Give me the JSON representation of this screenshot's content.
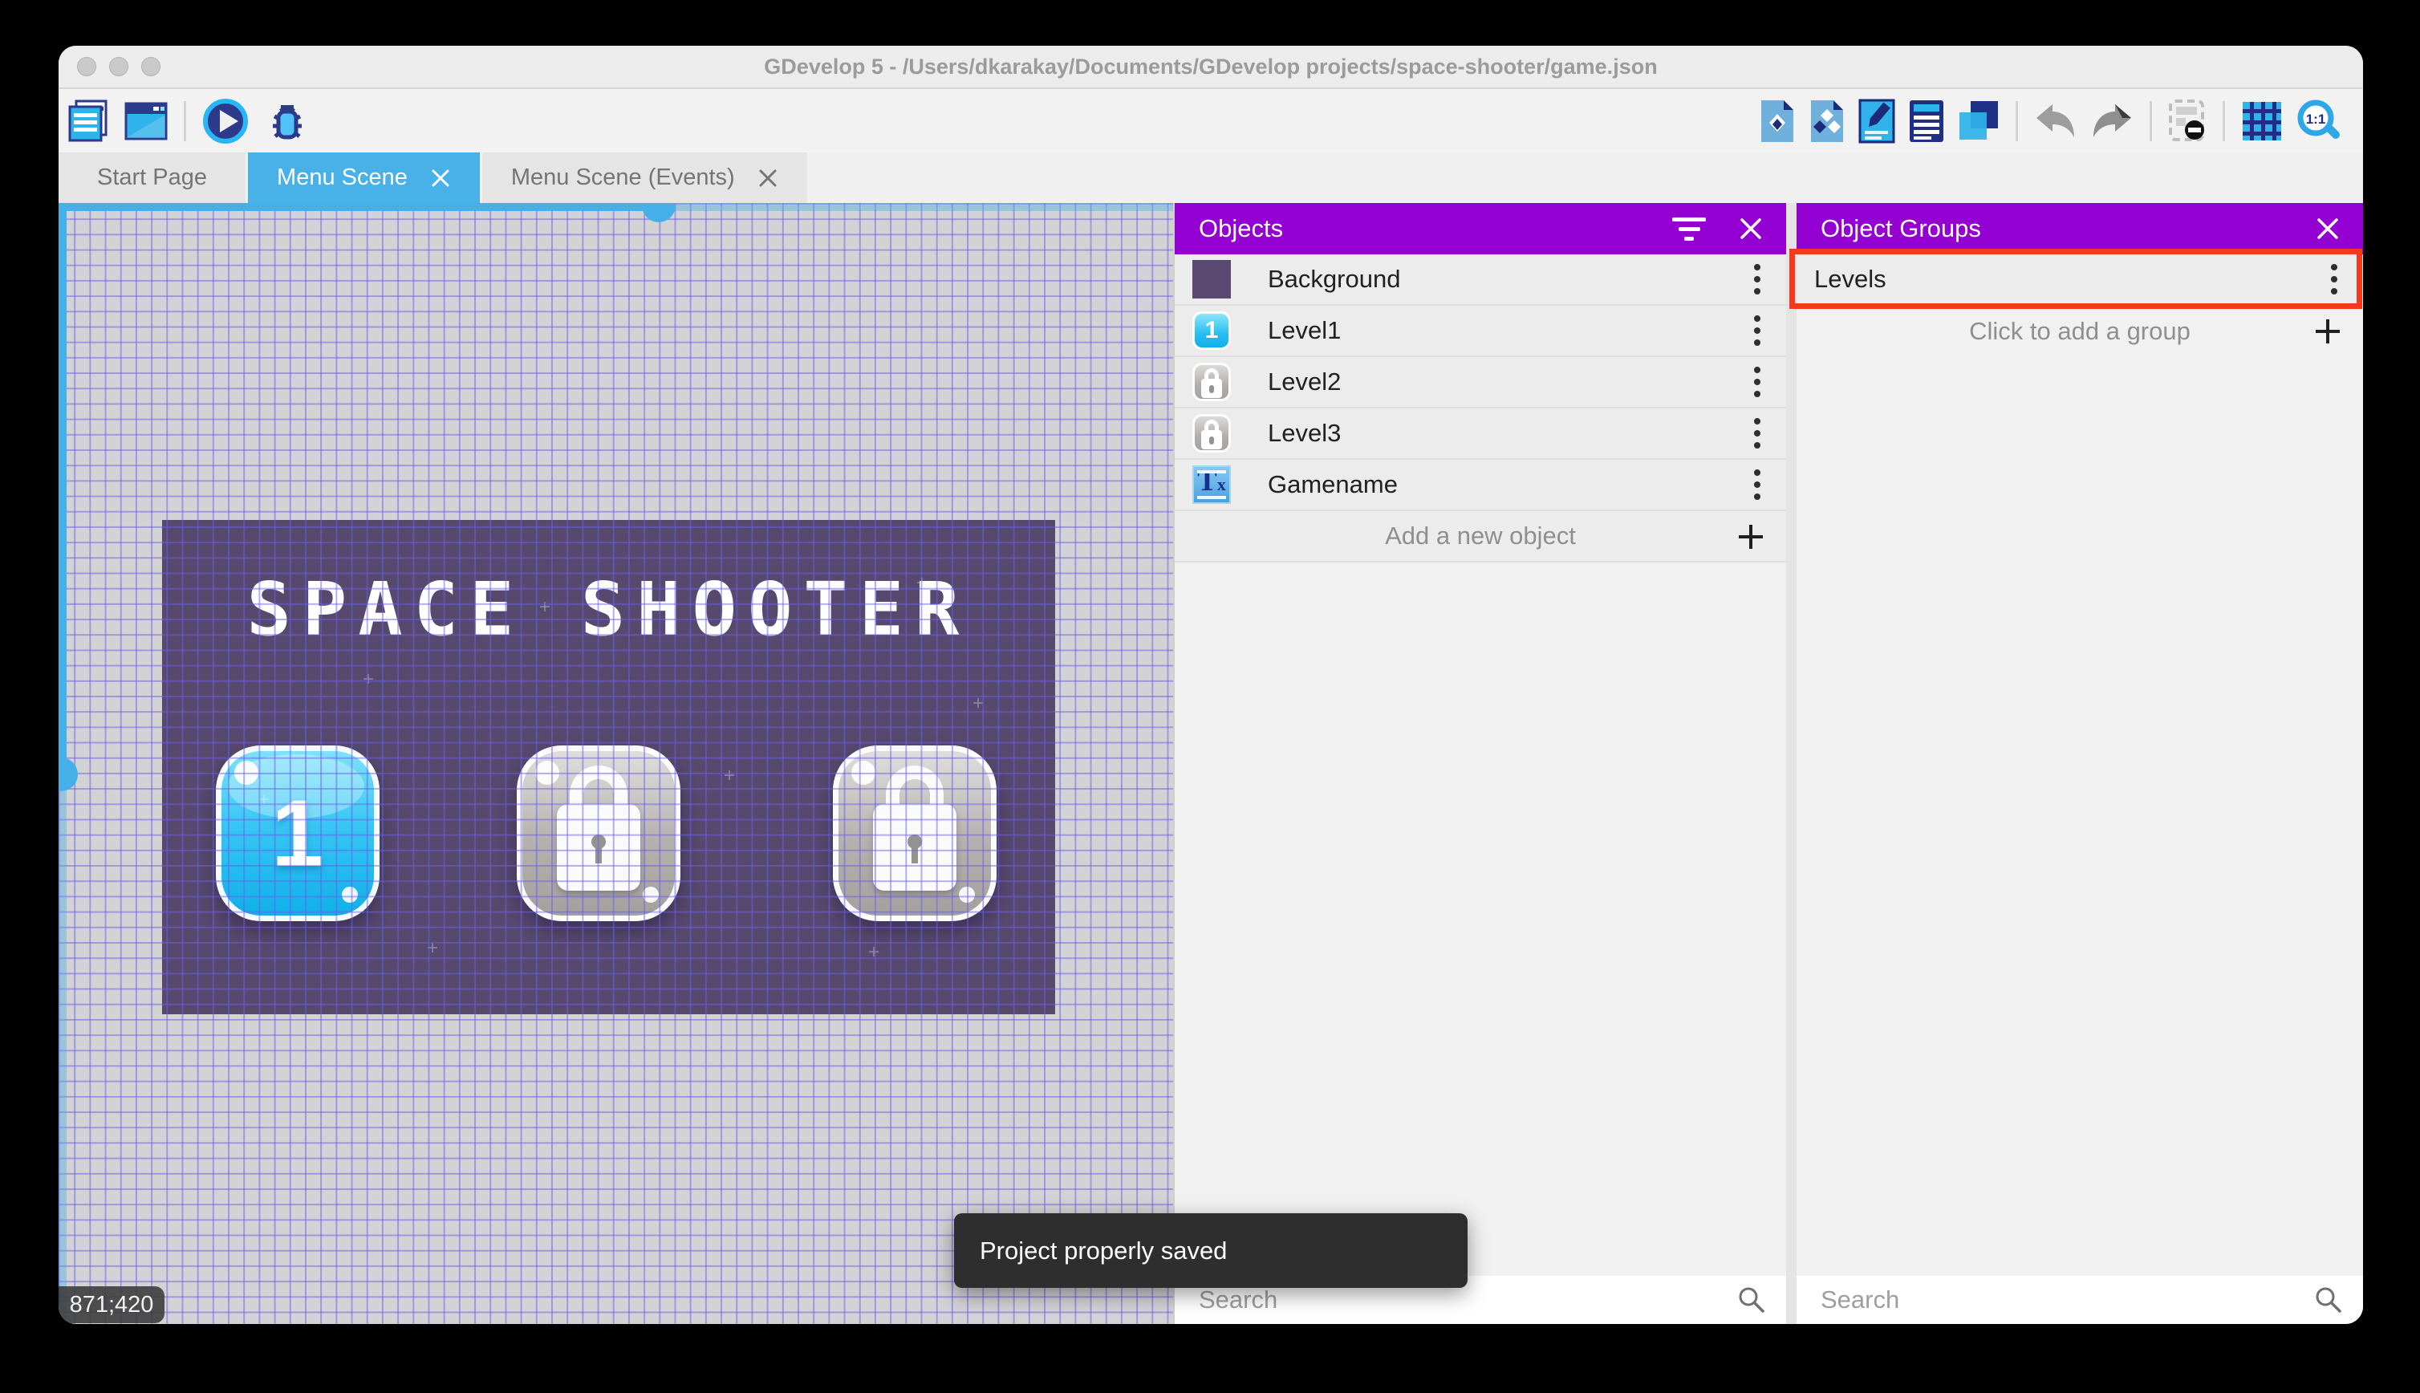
{
  "titlebar": {
    "title": "GDevelop 5 - /Users/dkarakay/Documents/GDevelop projects/space-shooter/game.json"
  },
  "tabs": {
    "start_page": "Start Page",
    "menu_scene": "Menu Scene",
    "menu_scene_events": "Menu Scene (Events)"
  },
  "scene": {
    "title": "SPACE SHOOTER",
    "coordinates": "871;420",
    "level1_label": "1"
  },
  "objects_panel": {
    "title": "Objects",
    "items": [
      {
        "name": "Background"
      },
      {
        "name": "Level1"
      },
      {
        "name": "Level2"
      },
      {
        "name": "Level3"
      },
      {
        "name": "Gamename"
      }
    ],
    "add_label": "Add a new object",
    "search_placeholder": "Search"
  },
  "object_groups_panel": {
    "title": "Object Groups",
    "groups": [
      {
        "name": "Levels"
      }
    ],
    "add_label": "Click to add a group",
    "search_placeholder": "Search"
  },
  "toast": {
    "message": "Project properly saved"
  },
  "colors": {
    "accent_blue": "#47b1e8",
    "panel_purple": "#9500d2",
    "highlight_red": "#f5391d",
    "scene_purple": "#57496d"
  }
}
